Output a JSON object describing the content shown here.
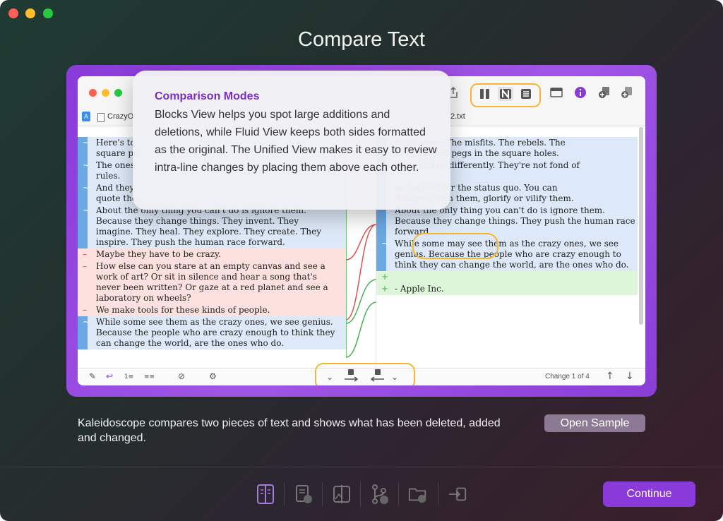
{
  "window": {
    "title": "Compare Text"
  },
  "preview": {
    "files": {
      "left": "CrazyOr",
      "right": "2.txt",
      "left_badge": "A"
    },
    "left_pane": {
      "blocks": [
        {
          "kind": "chg",
          "marker": "~",
          "lines": [
            "Here's to",
            "square pe"
          ]
        },
        {
          "kind": "chg",
          "marker": "~",
          "lines": [
            "The ones",
            "rules."
          ]
        },
        {
          "kind": "chg",
          "marker": "~",
          "lines": [
            "And they",
            "quote the"
          ]
        },
        {
          "kind": "chg",
          "marker": "~",
          "lines": [
            "About the only thing you can't do is ignore them.",
            "Because they change things. They invent. They",
            "imagine. They heal. They explore. They create. They",
            "inspire. They push the human race forward."
          ]
        },
        {
          "kind": "del",
          "marker": "–",
          "lines": [
            "Maybe they have to be crazy."
          ]
        },
        {
          "kind": "del",
          "marker": "–",
          "lines": [
            "How else can you stare at an empty canvas and see a",
            "work of art? Or sit in silence and hear a song that's",
            "never been written? Or gaze at a red planet and see a",
            "laboratory on wheels?"
          ]
        },
        {
          "kind": "del",
          "marker": "–",
          "lines": [
            "We make tools for these kinds of people."
          ]
        },
        {
          "kind": "chg",
          "marker": "~",
          "lines": [
            "While some see them as the crazy ones, we see genius.",
            "Because the people who are crazy enough to think they",
            "can change the world, are the ones who do."
          ]
        }
      ]
    },
    "right_pane": {
      "blocks": [
        {
          "kind": "chg",
          "marker": "",
          "lines": [
            "crazy ones. The misfits. The rebels. The",
            "s. The round pegs in the square holes."
          ]
        },
        {
          "kind": "chg",
          "marker": "",
          "lines": [
            "o see things differently. They're not fond of",
            ""
          ]
        },
        {
          "kind": "chg",
          "marker": "",
          "lines": [
            "no respect for the status quo.  You can",
            "disagree with them, glorify or vilify them."
          ]
        },
        {
          "kind": "chg",
          "marker": "",
          "lines": [
            "About the only thing you can't do is ignore them.",
            "Because they change things. They push the human race",
            "forward."
          ]
        },
        {
          "kind": "chg",
          "marker": "~",
          "lines": [
            "While some may see them as the crazy ones, we see",
            "genius. Because the people who are crazy enough to",
            "think they can change the world, are the ones who do."
          ]
        },
        {
          "kind": "add",
          "marker": "+",
          "lines": [
            ""
          ]
        },
        {
          "kind": "add",
          "marker": "+",
          "lines": [
            "- Apple Inc."
          ]
        }
      ]
    },
    "status": {
      "change_text": "Change 1 of 4"
    }
  },
  "popover": {
    "title": "Comparison Modes",
    "body": "Blocks View helps you spot large additions and deletions, while Fluid View keeps both sides formatted as the original. The Unified View makes it easy to review intra-line changes by placing them above each other."
  },
  "description": "Kaleidoscope compares two pieces of text and shows what has been deleted, added and changed.",
  "buttons": {
    "open_sample": "Open Sample",
    "continue": "Continue"
  },
  "colors": {
    "accent": "#8a3ad8",
    "highlight": "#f5b731",
    "changed": "#dde9f8",
    "deleted": "#fde1de",
    "added": "#ddf5d8"
  },
  "footer_icons": [
    "compare-text-icon",
    "document-merge-icon",
    "image-compare-icon",
    "git-branch-icon",
    "folder-sync-icon",
    "import-arrow-icon"
  ]
}
